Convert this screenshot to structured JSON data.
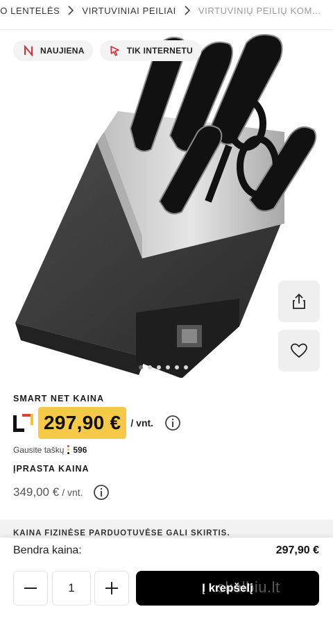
{
  "breadcrumb": {
    "items": [
      "IO LENTELĖS",
      "VIRTUVINIAI PEILIAI",
      "VIRTUVINIŲ PEILIŲ KOM..."
    ]
  },
  "badges": [
    {
      "icon": "n-icon",
      "label": "NAUJIENA",
      "color": "#d6303a"
    },
    {
      "icon": "cursor-icon",
      "label": "TIK INTERNETU",
      "color": "#d6303a"
    }
  ],
  "gallery": {
    "dots": 6,
    "active_index": 0
  },
  "smart_net": {
    "label": "SMART NET KAINA",
    "price": "297,90 €",
    "unit": "/ vnt.",
    "points_label": "Gausite taškų",
    "points_value": "596"
  },
  "regular": {
    "label": "ĮPRASTA KAINA",
    "price": "349,00 €",
    "unit": "/ vnt."
  },
  "notice": "KAINA FIZINĖSE PARDUOTUVĖSE GALI SKIRTIS.",
  "bottom": {
    "total_label": "Bendra kaina:",
    "total_value": "297,90 €",
    "quantity": "1",
    "cart_label": "Į krepšelį"
  },
  "watermark": "skelbiu.lt",
  "colors": {
    "price_highlight": "#f7c948",
    "cart_button": "#000000",
    "accent_red": "#d6303a"
  }
}
